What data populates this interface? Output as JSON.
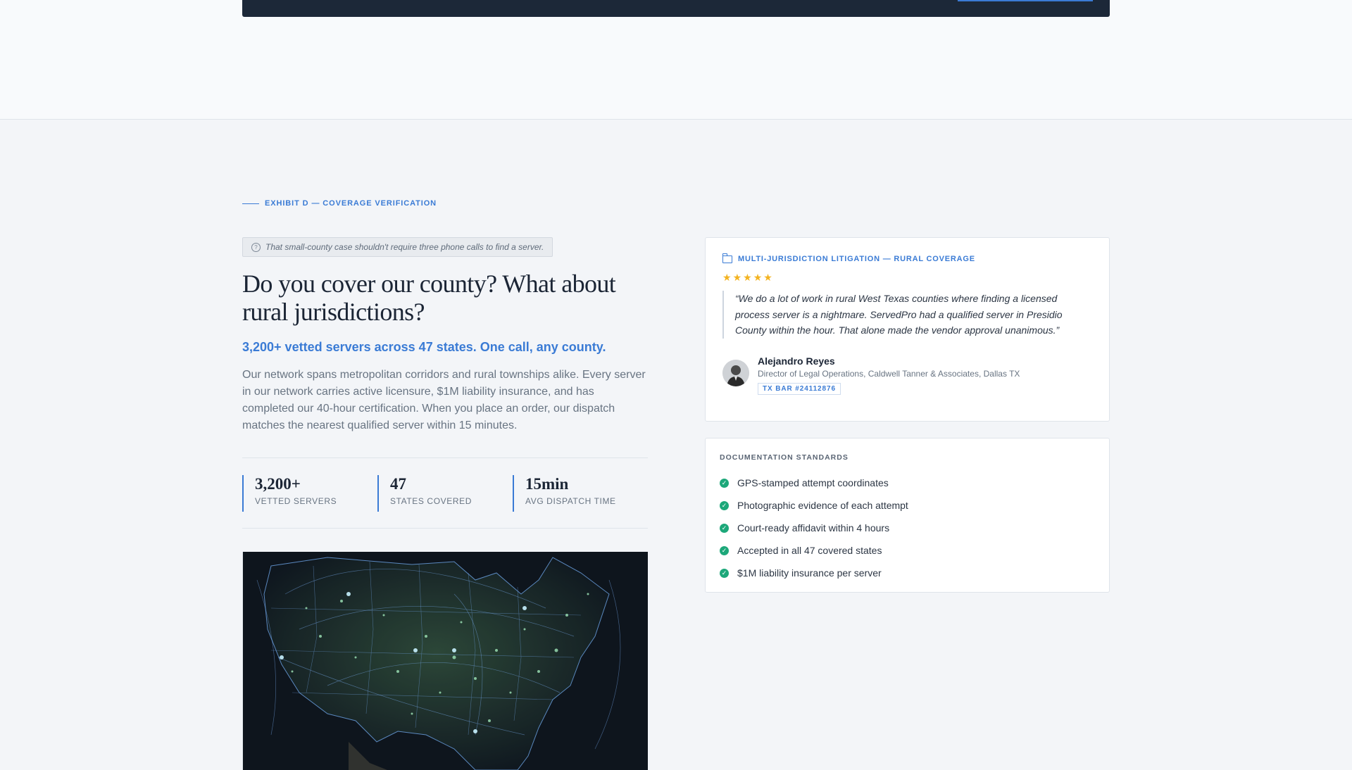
{
  "header": {},
  "section": {
    "eyebrow": "EXHIBIT D — COVERAGE VERIFICATION",
    "pain_point": "That small-county case shouldn't require three phone calls to find a server.",
    "headline": "Do you cover our county? What about rural jurisdictions?",
    "subhead": "3,200+ vetted servers across 47 states. One call, any county.",
    "body": "Our network spans metropolitan corridors and rural townships alike. Every server in our network carries active licensure, $1M liability insurance, and has completed our 40-hour certification. When you place an order, our dispatch matches the nearest qualified server within 15 minutes.",
    "stats": [
      {
        "value": "3,200+",
        "label": "VETTED SERVERS"
      },
      {
        "value": "47",
        "label": "STATES COVERED"
      },
      {
        "value": "15min",
        "label": "AVG DISPATCH TIME"
      }
    ]
  },
  "testimonial": {
    "case_label": "MULTI-JURISDICTION LITIGATION — RURAL COVERAGE",
    "rating": 5,
    "quote": "“We do a lot of work in rural West Texas counties where finding a licensed process server is a nightmare. ServedPro had a qualified server in Presidio County within the hour. That alone made the vendor approval unanimous.”",
    "author_name": "Alejandro Reyes",
    "author_title": "Director of Legal Operations, Caldwell Tanner & Associates, Dallas TX",
    "bar_badge": "TX BAR #24112876"
  },
  "documentation": {
    "title": "DOCUMENTATION STANDARDS",
    "items": [
      "GPS-stamped attempt coordinates",
      "Photographic evidence of each attempt",
      "Court-ready affidavit within 4 hours",
      "Accepted in all 47 covered states",
      "$1M liability insurance per server"
    ]
  },
  "colors": {
    "accent": "#3a7bd5",
    "dark_bar": "#1c2838",
    "check": "#1da87a",
    "star": "#f3b320"
  },
  "icons": [
    "question-circle-icon",
    "folder-icon",
    "star-icon",
    "check-circle-icon"
  ]
}
